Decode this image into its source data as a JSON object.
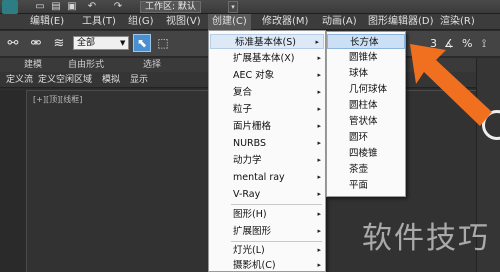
{
  "titlebar": {
    "workspace_label": "工作区: 默认",
    "workspace_arrow": "▾"
  },
  "menubar": {
    "items": [
      "编辑(E)",
      "工具(T)",
      "组(G)",
      "视图(V)",
      "创建(C)",
      "修改器(M)",
      "动画(A)",
      "图形编辑器(D)",
      "渲染(R)"
    ]
  },
  "toolbar": {
    "selection_filter": "全部"
  },
  "ribbon": {
    "labels": [
      "建模",
      "自由形式",
      "选择"
    ]
  },
  "subbar": {
    "items": [
      "定义流",
      "定义空闲区域",
      "模拟",
      "显示"
    ]
  },
  "viewport": {
    "label": "[+][顶][线框]"
  },
  "create_menu": {
    "items": [
      {
        "label": "标准基本体(S)",
        "arrow": "▸",
        "highlight": true
      },
      {
        "label": "扩展基本体(X)",
        "arrow": "▸"
      },
      {
        "label": "AEC 对象",
        "arrow": "▸"
      },
      {
        "label": "复合",
        "arrow": "▸"
      },
      {
        "label": "粒子",
        "arrow": "▸"
      },
      {
        "label": "面片栅格",
        "arrow": "▸"
      },
      {
        "label": "NURBS",
        "arrow": "▸"
      },
      {
        "label": "动力学",
        "arrow": "▸"
      },
      {
        "label": "mental ray",
        "arrow": "▸"
      },
      {
        "label": "V-Ray",
        "arrow": "▸"
      },
      {
        "label": "图形(H)",
        "arrow": "▸"
      },
      {
        "label": "扩展图形",
        "arrow": "▸"
      },
      {
        "label": "灯光(L)",
        "arrow": "▸"
      },
      {
        "label": "摄影机(C)",
        "arrow": "▸"
      }
    ]
  },
  "sub_menu": {
    "items": [
      "长方体",
      "圆锥体",
      "球体",
      "几何球体",
      "圆柱体",
      "管状体",
      "圆环",
      "四棱锥",
      "茶壶",
      "平面"
    ]
  },
  "right_toolbar": {
    "number": "3"
  },
  "watermark": "软件技巧",
  "colors": {
    "menu_highlight": "#cce0f5",
    "select_button": "#4a90d0",
    "annotation_arrow": "#f07020"
  }
}
